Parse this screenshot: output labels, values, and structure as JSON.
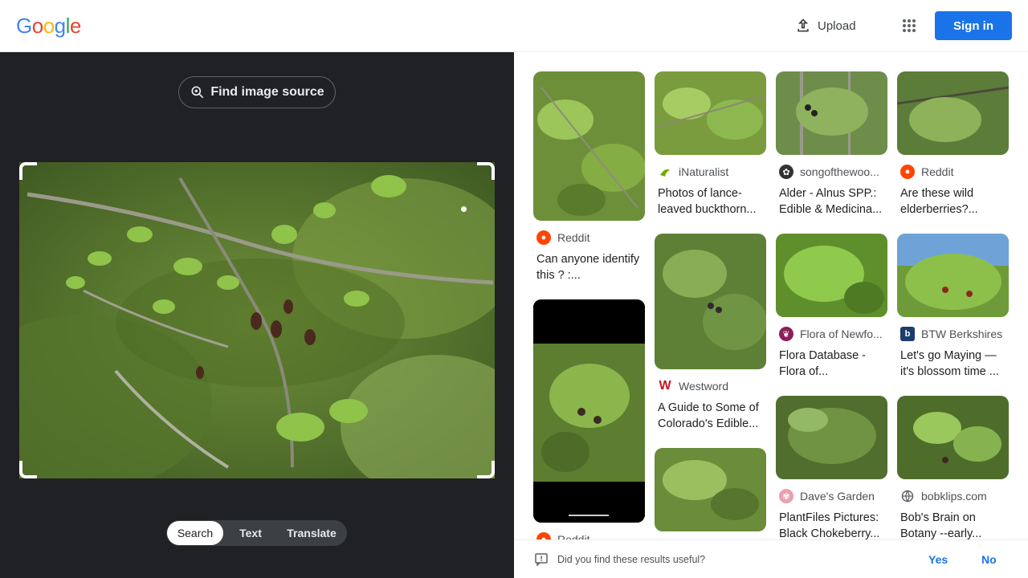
{
  "header": {
    "logo_letters": [
      "G",
      "o",
      "o",
      "g",
      "l",
      "e"
    ],
    "upload_label": "Upload",
    "signin_label": "Sign in"
  },
  "left_pane": {
    "find_source_label": "Find image source",
    "modes": [
      {
        "label": "Search",
        "active": true
      },
      {
        "label": "Text",
        "active": false
      },
      {
        "label": "Translate",
        "active": false
      }
    ]
  },
  "results": [
    {
      "source": "Reddit",
      "title": "Can anyone identify this ? :...",
      "favicon": "reddit-icon"
    },
    {
      "source": "Reddit",
      "title": "",
      "favicon": "reddit-icon"
    },
    {
      "source": "iNaturalist",
      "title": "Photos of lance-leaved buckthorn...",
      "favicon": "inaturalist-icon"
    },
    {
      "source": "Westword",
      "title": "A Guide to Some of Colorado's Edible...",
      "favicon": "westword-icon"
    },
    {
      "source": "songofthewoo...",
      "title": "Alder - Alnus SPP.: Edible & Medicina...",
      "favicon": "songofthewoods-icon"
    },
    {
      "source": "Flora of Newfo...",
      "title": "Flora Database - Flora of...",
      "favicon": "flora-icon"
    },
    {
      "source": "Dave's Garden",
      "title": "PlantFiles Pictures: Black Chokeberry...",
      "favicon": "davesgarden-icon"
    },
    {
      "source": "Reddit",
      "title": "Are these wild elderberries?...",
      "favicon": "reddit-icon"
    },
    {
      "source": "BTW Berkshires",
      "title": "Let's go Maying — it's blossom time ...",
      "favicon": "btw-icon"
    },
    {
      "source": "bobklips.com",
      "title": "Bob's Brain on Botany --early...",
      "favicon": "globe-icon"
    }
  ],
  "feedback": {
    "question": "Did you find these results useful?",
    "yes_label": "Yes",
    "no_label": "No"
  },
  "colors": {
    "accent": "#1a73e8",
    "left_bg": "#202124"
  }
}
